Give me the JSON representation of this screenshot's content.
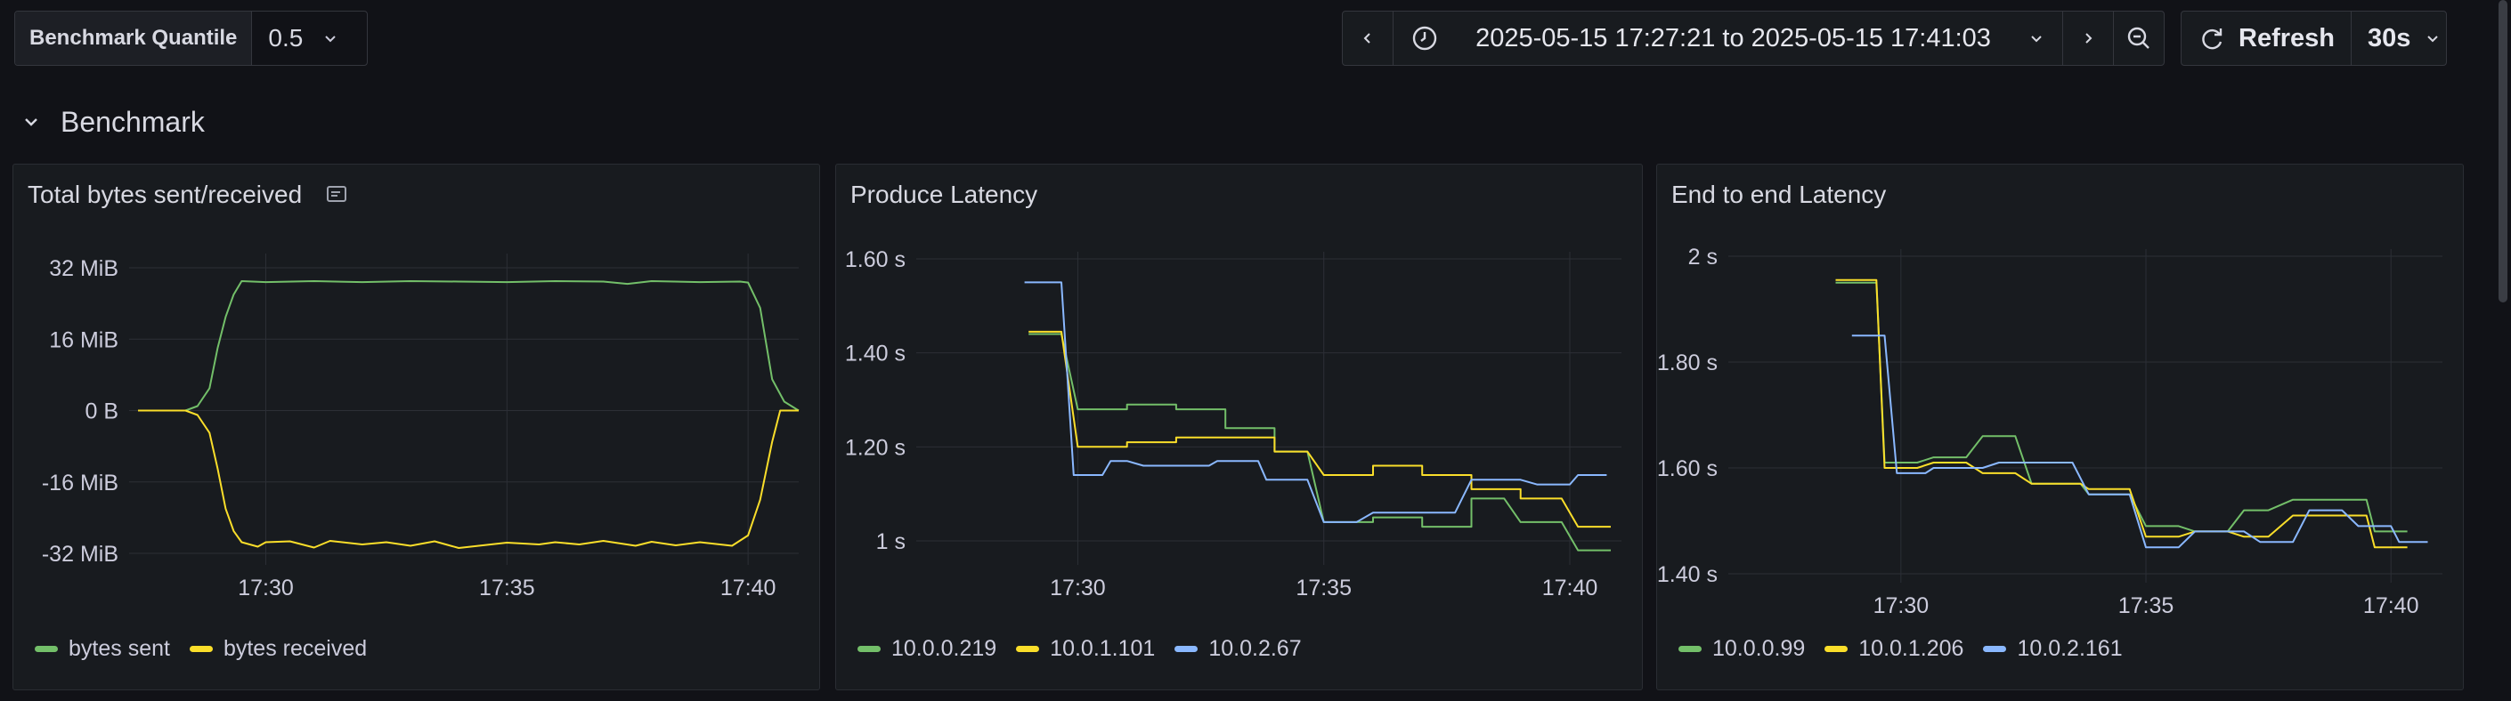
{
  "toolbar": {
    "variable_label": "Benchmark Quantile",
    "variable_value": "0.5",
    "time_range": "2025-05-15 17:27:21 to 2025-05-15 17:41:03",
    "refresh_label": "Refresh",
    "refresh_interval": "30s"
  },
  "row": {
    "title": "Benchmark"
  },
  "colors": {
    "green": "#73bf69",
    "yellow": "#fade2a",
    "blue": "#8ab8ff"
  },
  "chart_data": [
    {
      "type": "line",
      "title": "Total bytes sent/received",
      "xlabel": "",
      "ylabel": "",
      "x_ticks": [
        "17:30",
        "17:35",
        "17:40"
      ],
      "y_ticks": [
        "32 MiB",
        "16 MiB",
        "0 B",
        "-16 MiB",
        "-32 MiB"
      ],
      "ylim": [
        -36,
        36
      ],
      "x_range": [
        "17:27:21",
        "17:41:03"
      ],
      "grid": true,
      "legend": "bottom-left",
      "series": [
        {
          "name": "bytes sent",
          "color": "#73bf69",
          "points": [
            [
              "17:27:21",
              0
            ],
            [
              "17:28:20",
              0
            ],
            [
              "17:28:35",
              1
            ],
            [
              "17:28:50",
              5
            ],
            [
              "17:29:00",
              14
            ],
            [
              "17:29:10",
              21
            ],
            [
              "17:29:20",
              26
            ],
            [
              "17:29:30",
              29
            ],
            [
              "17:30:00",
              28.8
            ],
            [
              "17:31:00",
              29
            ],
            [
              "17:32:00",
              28.8
            ],
            [
              "17:33:00",
              29
            ],
            [
              "17:34:00",
              28.9
            ],
            [
              "17:35:00",
              28.8
            ],
            [
              "17:36:00",
              29
            ],
            [
              "17:37:00",
              28.9
            ],
            [
              "17:37:30",
              28.4
            ],
            [
              "17:38:00",
              29
            ],
            [
              "17:39:00",
              28.8
            ],
            [
              "17:39:50",
              28.9
            ],
            [
              "17:40:00",
              28.7
            ],
            [
              "17:40:15",
              23
            ],
            [
              "17:40:30",
              7
            ],
            [
              "17:40:45",
              2
            ],
            [
              "17:41:03",
              0
            ]
          ]
        },
        {
          "name": "bytes received",
          "color": "#fade2a",
          "points": [
            [
              "17:27:21",
              0
            ],
            [
              "17:28:20",
              0
            ],
            [
              "17:28:35",
              -1
            ],
            [
              "17:28:50",
              -5
            ],
            [
              "17:29:00",
              -13
            ],
            [
              "17:29:10",
              -22
            ],
            [
              "17:29:20",
              -27
            ],
            [
              "17:29:30",
              -29.5
            ],
            [
              "17:29:50",
              -30.5
            ],
            [
              "17:30:00",
              -29.5
            ],
            [
              "17:30:30",
              -29.3
            ],
            [
              "17:31:00",
              -30.7
            ],
            [
              "17:31:20",
              -29.2
            ],
            [
              "17:32:00",
              -30
            ],
            [
              "17:32:30",
              -29.5
            ],
            [
              "17:33:00",
              -30.3
            ],
            [
              "17:33:30",
              -29.3
            ],
            [
              "17:34:00",
              -30.8
            ],
            [
              "17:35:00",
              -29.6
            ],
            [
              "17:35:40",
              -30
            ],
            [
              "17:36:00",
              -29.5
            ],
            [
              "17:36:30",
              -30
            ],
            [
              "17:37:00",
              -29.2
            ],
            [
              "17:37:40",
              -30.3
            ],
            [
              "17:38:00",
              -29.4
            ],
            [
              "17:38:30",
              -30.2
            ],
            [
              "17:39:00",
              -29.5
            ],
            [
              "17:39:40",
              -30.3
            ],
            [
              "17:40:00",
              -28
            ],
            [
              "17:40:15",
              -20
            ],
            [
              "17:40:30",
              -7
            ],
            [
              "17:40:40",
              0
            ],
            [
              "17:41:03",
              0
            ]
          ]
        }
      ]
    },
    {
      "type": "line",
      "title": "Produce Latency",
      "xlabel": "",
      "ylabel": "",
      "x_ticks": [
        "17:30",
        "17:35",
        "17:40"
      ],
      "y_ticks": [
        "1.60 s",
        "1.40 s",
        "1.20 s",
        "1 s"
      ],
      "ylim": [
        0.94,
        1.66
      ],
      "x_range": [
        "17:27:21",
        "17:41:03"
      ],
      "grid": true,
      "legend": "bottom-left",
      "series": [
        {
          "name": "10.0.0.219",
          "color": "#73bf69",
          "points": [
            [
              "17:29:00",
              1.44
            ],
            [
              "17:29:40",
              1.44
            ],
            [
              "17:30:00",
              1.28
            ],
            [
              "17:31:00",
              1.28
            ],
            [
              "17:31:00",
              1.29
            ],
            [
              "17:32:00",
              1.29
            ],
            [
              "17:32:00",
              1.28
            ],
            [
              "17:33:00",
              1.28
            ],
            [
              "17:33:00",
              1.24
            ],
            [
              "17:34:00",
              1.24
            ],
            [
              "17:34:00",
              1.19
            ],
            [
              "17:34:40",
              1.19
            ],
            [
              "17:35:00",
              1.04
            ],
            [
              "17:36:00",
              1.04
            ],
            [
              "17:36:00",
              1.05
            ],
            [
              "17:37:00",
              1.05
            ],
            [
              "17:37:00",
              1.03
            ],
            [
              "17:38:00",
              1.03
            ],
            [
              "17:38:00",
              1.09
            ],
            [
              "17:38:40",
              1.09
            ],
            [
              "17:39:00",
              1.04
            ],
            [
              "17:39:50",
              1.04
            ],
            [
              "17:40:10",
              0.98
            ],
            [
              "17:40:50",
              0.98
            ]
          ]
        },
        {
          "name": "10.0.1.101",
          "color": "#fade2a",
          "points": [
            [
              "17:29:00",
              1.445
            ],
            [
              "17:29:40",
              1.445
            ],
            [
              "17:30:00",
              1.2
            ],
            [
              "17:31:00",
              1.2
            ],
            [
              "17:31:00",
              1.21
            ],
            [
              "17:32:00",
              1.21
            ],
            [
              "17:32:00",
              1.22
            ],
            [
              "17:34:00",
              1.22
            ],
            [
              "17:34:00",
              1.19
            ],
            [
              "17:34:40",
              1.19
            ],
            [
              "17:35:00",
              1.14
            ],
            [
              "17:36:00",
              1.14
            ],
            [
              "17:36:00",
              1.16
            ],
            [
              "17:37:00",
              1.16
            ],
            [
              "17:37:00",
              1.14
            ],
            [
              "17:38:00",
              1.14
            ],
            [
              "17:38:00",
              1.11
            ],
            [
              "17:39:00",
              1.11
            ],
            [
              "17:39:00",
              1.09
            ],
            [
              "17:39:50",
              1.09
            ],
            [
              "17:40:10",
              1.03
            ],
            [
              "17:40:50",
              1.03
            ]
          ]
        },
        {
          "name": "10.0.2.67",
          "color": "#8ab8ff",
          "points": [
            [
              "17:28:55",
              1.55
            ],
            [
              "17:29:40",
              1.55
            ],
            [
              "17:29:55",
              1.14
            ],
            [
              "17:30:30",
              1.14
            ],
            [
              "17:30:40",
              1.17
            ],
            [
              "17:31:00",
              1.17
            ],
            [
              "17:31:20",
              1.16
            ],
            [
              "17:32:40",
              1.16
            ],
            [
              "17:32:50",
              1.17
            ],
            [
              "17:33:40",
              1.17
            ],
            [
              "17:33:50",
              1.13
            ],
            [
              "17:34:40",
              1.13
            ],
            [
              "17:35:00",
              1.04
            ],
            [
              "17:35:40",
              1.04
            ],
            [
              "17:36:00",
              1.06
            ],
            [
              "17:37:40",
              1.06
            ],
            [
              "17:38:00",
              1.13
            ],
            [
              "17:39:00",
              1.13
            ],
            [
              "17:39:20",
              1.12
            ],
            [
              "17:40:00",
              1.12
            ],
            [
              "17:40:10",
              1.14
            ],
            [
              "17:40:45",
              1.14
            ]
          ]
        }
      ]
    },
    {
      "type": "line",
      "title": "End to end Latency",
      "xlabel": "",
      "ylabel": "",
      "x_ticks": [
        "17:30",
        "17:35",
        "17:40"
      ],
      "y_ticks": [
        "2 s",
        "1.80 s",
        "1.60 s",
        "1.40 s"
      ],
      "ylim": [
        1.37,
        2.03
      ],
      "x_range": [
        "17:27:21",
        "17:41:03"
      ],
      "grid": true,
      "legend": "bottom-left",
      "series": [
        {
          "name": "10.0.0.99",
          "color": "#73bf69",
          "points": [
            [
              "17:28:40",
              1.95
            ],
            [
              "17:29:30",
              1.95
            ],
            [
              "17:29:40",
              1.61
            ],
            [
              "17:30:20",
              1.61
            ],
            [
              "17:30:40",
              1.62
            ],
            [
              "17:31:20",
              1.62
            ],
            [
              "17:31:40",
              1.66
            ],
            [
              "17:32:20",
              1.66
            ],
            [
              "17:32:40",
              1.57
            ],
            [
              "17:33:40",
              1.57
            ],
            [
              "17:33:50",
              1.55
            ],
            [
              "17:34:40",
              1.55
            ],
            [
              "17:35:00",
              1.49
            ],
            [
              "17:35:40",
              1.49
            ],
            [
              "17:36:00",
              1.48
            ],
            [
              "17:36:40",
              1.48
            ],
            [
              "17:37:00",
              1.52
            ],
            [
              "17:37:30",
              1.52
            ],
            [
              "17:38:00",
              1.54
            ],
            [
              "17:39:30",
              1.54
            ],
            [
              "17:39:40",
              1.48
            ],
            [
              "17:40:20",
              1.48
            ]
          ]
        },
        {
          "name": "10.0.1.206",
          "color": "#fade2a",
          "points": [
            [
              "17:28:40",
              1.955
            ],
            [
              "17:29:30",
              1.955
            ],
            [
              "17:29:40",
              1.6
            ],
            [
              "17:30:20",
              1.6
            ],
            [
              "17:30:40",
              1.61
            ],
            [
              "17:31:20",
              1.61
            ],
            [
              "17:31:40",
              1.59
            ],
            [
              "17:32:20",
              1.59
            ],
            [
              "17:32:40",
              1.57
            ],
            [
              "17:33:40",
              1.57
            ],
            [
              "17:33:50",
              1.56
            ],
            [
              "17:34:40",
              1.56
            ],
            [
              "17:35:00",
              1.47
            ],
            [
              "17:35:40",
              1.47
            ],
            [
              "17:36:00",
              1.48
            ],
            [
              "17:36:40",
              1.48
            ],
            [
              "17:37:00",
              1.47
            ],
            [
              "17:37:30",
              1.47
            ],
            [
              "17:38:00",
              1.51
            ],
            [
              "17:39:30",
              1.51
            ],
            [
              "17:39:40",
              1.45
            ],
            [
              "17:40:20",
              1.45
            ]
          ]
        },
        {
          "name": "10.0.2.161",
          "color": "#8ab8ff",
          "points": [
            [
              "17:29:00",
              1.85
            ],
            [
              "17:29:40",
              1.85
            ],
            [
              "17:29:55",
              1.59
            ],
            [
              "17:30:30",
              1.59
            ],
            [
              "17:30:40",
              1.6
            ],
            [
              "17:31:40",
              1.6
            ],
            [
              "17:32:00",
              1.61
            ],
            [
              "17:33:30",
              1.61
            ],
            [
              "17:33:50",
              1.55
            ],
            [
              "17:34:40",
              1.55
            ],
            [
              "17:35:00",
              1.45
            ],
            [
              "17:35:40",
              1.45
            ],
            [
              "17:36:00",
              1.48
            ],
            [
              "17:37:00",
              1.48
            ],
            [
              "17:37:20",
              1.46
            ],
            [
              "17:38:00",
              1.46
            ],
            [
              "17:38:20",
              1.52
            ],
            [
              "17:39:00",
              1.52
            ],
            [
              "17:39:20",
              1.49
            ],
            [
              "17:40:00",
              1.49
            ],
            [
              "17:40:10",
              1.46
            ],
            [
              "17:40:45",
              1.46
            ]
          ]
        }
      ]
    }
  ]
}
